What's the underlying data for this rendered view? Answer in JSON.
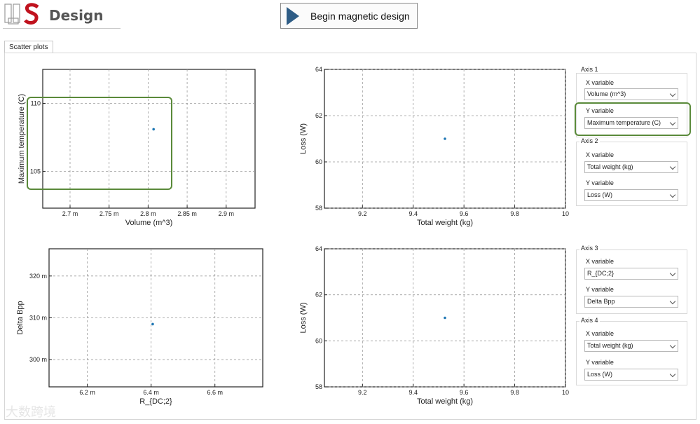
{
  "header": {
    "logo_text": "Design",
    "begin_button": "Begin magnetic design"
  },
  "tabs": [
    {
      "label": "Scatter plots"
    }
  ],
  "axis_panels": [
    {
      "title": "Axis 1",
      "x_label": "X variable",
      "x_value": "Volume (m^3)",
      "y_label": "Y variable",
      "y_value": "Maximum temperature (C)"
    },
    {
      "title": "Axis 2",
      "x_label": "X variable",
      "x_value": "Total weight (kg)",
      "y_label": "Y variable",
      "y_value": "Loss (W)"
    },
    {
      "title": "Axis 3",
      "x_label": "X variable",
      "x_value": "R_{DC;2}",
      "y_label": "Y variable",
      "y_value": "Delta Bpp"
    },
    {
      "title": "Axis 4",
      "x_label": "X variable",
      "x_value": "Total weight (kg)",
      "y_label": "Y variable",
      "y_value": "Loss (W)"
    }
  ],
  "chart_data": [
    {
      "type": "scatter",
      "xlabel": "Volume (m^3)",
      "ylabel": "Maximum temperature (C)",
      "xlim": [
        0.002665,
        0.002937
      ],
      "ylim": [
        102.3,
        112.5
      ],
      "xticks": [
        {
          "v": 0.0027,
          "label": "2.7 m"
        },
        {
          "v": 0.00275,
          "label": "2.75 m"
        },
        {
          "v": 0.0028,
          "label": "2.8 m"
        },
        {
          "v": 0.00285,
          "label": "2.85 m"
        },
        {
          "v": 0.0029,
          "label": "2.9 m"
        }
      ],
      "yticks": [
        {
          "v": 105,
          "label": "105"
        },
        {
          "v": 110,
          "label": "110"
        }
      ],
      "points": [
        {
          "x": 0.002807,
          "y": 108.1
        }
      ],
      "color": "#1f77b4"
    },
    {
      "type": "scatter",
      "xlabel": "Total weight (kg)",
      "ylabel": "Loss (W)",
      "xlim": [
        9.05,
        10.0
      ],
      "ylim": [
        58,
        64
      ],
      "xticks": [
        {
          "v": 9.2,
          "label": "9.2"
        },
        {
          "v": 9.4,
          "label": "9.4"
        },
        {
          "v": 9.6,
          "label": "9.6"
        },
        {
          "v": 9.8,
          "label": "9.8"
        },
        {
          "v": 10,
          "label": "10"
        }
      ],
      "yticks": [
        {
          "v": 58,
          "label": "58"
        },
        {
          "v": 60,
          "label": "60"
        },
        {
          "v": 62,
          "label": "62"
        },
        {
          "v": 64,
          "label": "64"
        }
      ],
      "points": [
        {
          "x": 9.525,
          "y": 61.0
        }
      ],
      "color": "#1f77b4"
    },
    {
      "type": "scatter",
      "xlabel": "R_{DC;2}",
      "ylabel": "Delta Bpp",
      "xlim": [
        6.08,
        6.75
      ],
      "ylim": [
        0.2935,
        0.3265
      ],
      "xticks": [
        {
          "v": 6.2,
          "label": "6.2 m"
        },
        {
          "v": 6.4,
          "label": "6.4 m"
        },
        {
          "v": 6.6,
          "label": "6.6 m"
        }
      ],
      "yticks": [
        {
          "v": 0.3,
          "label": "300 m"
        },
        {
          "v": 0.31,
          "label": "310 m"
        },
        {
          "v": 0.32,
          "label": "320 m"
        }
      ],
      "points": [
        {
          "x": 6.405,
          "y": 0.3085
        }
      ],
      "color": "#1f77b4"
    },
    {
      "type": "scatter",
      "xlabel": "Total weight (kg)",
      "ylabel": "Loss (W)",
      "xlim": [
        9.05,
        10.0
      ],
      "ylim": [
        58,
        64
      ],
      "xticks": [
        {
          "v": 9.2,
          "label": "9.2"
        },
        {
          "v": 9.4,
          "label": "9.4"
        },
        {
          "v": 9.6,
          "label": "9.6"
        },
        {
          "v": 9.8,
          "label": "9.8"
        },
        {
          "v": 10,
          "label": "10"
        }
      ],
      "yticks": [
        {
          "v": 58,
          "label": "58"
        },
        {
          "v": 60,
          "label": "60"
        },
        {
          "v": 62,
          "label": "62"
        },
        {
          "v": 64,
          "label": "64"
        }
      ],
      "points": [
        {
          "x": 9.525,
          "y": 61.0
        }
      ],
      "color": "#1f77b4"
    }
  ],
  "watermark": "大数跨境",
  "colors": {
    "highlight": "#5a8a3a",
    "button_icon": "#2f5d86",
    "point": "#1f77b4",
    "logo_red": "#c0121e"
  }
}
